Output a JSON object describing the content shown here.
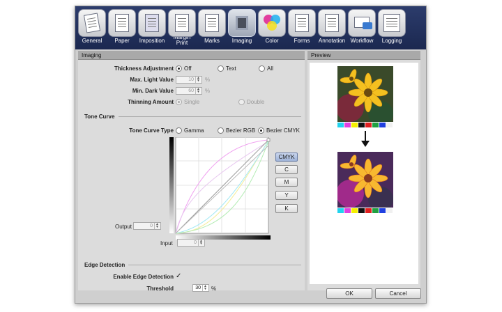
{
  "toolbar": {
    "tabs": [
      {
        "label": "General",
        "icon": "general-icon"
      },
      {
        "label": "Paper",
        "icon": "paper-icon"
      },
      {
        "label": "Imposition",
        "icon": "imposition-icon"
      },
      {
        "label": "Margin Print",
        "icon": "margin-print-icon"
      },
      {
        "label": "Marks",
        "icon": "marks-icon"
      },
      {
        "label": "Imaging",
        "icon": "imaging-icon",
        "active": true
      },
      {
        "label": "Color",
        "icon": "color-icon"
      },
      {
        "label": "Forms",
        "icon": "forms-icon"
      },
      {
        "label": "Annotation",
        "icon": "annotation-icon"
      },
      {
        "label": "Workflow",
        "icon": "workflow-icon"
      },
      {
        "label": "Logging",
        "icon": "logging-icon"
      }
    ]
  },
  "imaging": {
    "title": "Imaging",
    "thickness_label": "Thickness Adjustment",
    "thickness_options": [
      "Off",
      "Text",
      "All"
    ],
    "thickness_selected": "Off",
    "max_light_label": "Max. Light Value",
    "max_light_value": "10",
    "min_dark_label": "Min. Dark Value",
    "min_dark_value": "60",
    "percent": "%",
    "thinning_label": "Thinning Amount",
    "thinning_options": [
      "Single",
      "Double"
    ],
    "thinning_selected": "Single"
  },
  "tone_curve": {
    "section_title": "Tone Curve",
    "type_label": "Tone Curve Type",
    "type_options": [
      "Gamma",
      "Bezier RGB",
      "Bezier CMYK"
    ],
    "type_selected": "Bezier CMYK",
    "channels": [
      "CMYK",
      "C",
      "M",
      "Y",
      "K"
    ],
    "channel_selected": "CMYK",
    "output_label": "Output",
    "output_value": "0",
    "input_label": "Input",
    "input_value": "0"
  },
  "edge": {
    "section_title": "Edge Detection",
    "enable_label": "Enable Edge Detection",
    "enabled": true,
    "threshold_label": "Threshold",
    "threshold_value": "30",
    "percent": "%"
  },
  "preview": {
    "title": "Preview",
    "swatch_colors": [
      "#22d3ee",
      "#e040e0",
      "#f5f000",
      "#111111",
      "#e02020",
      "#20a040",
      "#2040e0",
      "#f0f0f0"
    ]
  },
  "footer": {
    "ok_label": "OK",
    "cancel_label": "Cancel"
  },
  "colors": {
    "toolbar_bg": "#1b2850",
    "curve_magenta": "#f0a0f0",
    "curve_yellow": "#f4ee9a",
    "curve_cyan": "#a0e8f4",
    "curve_green": "#b4ecb4",
    "curve_gray": "#9a9a9a"
  }
}
